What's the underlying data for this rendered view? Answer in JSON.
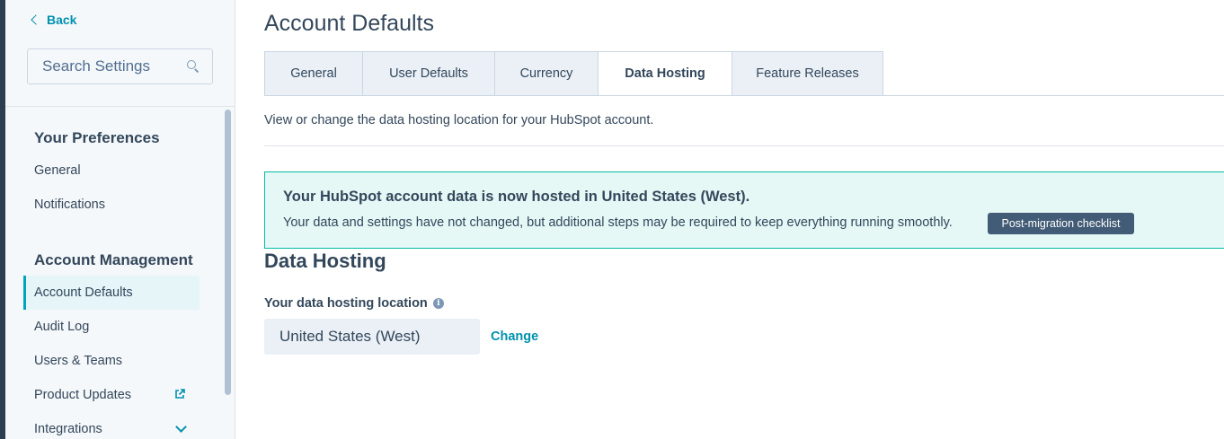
{
  "sidebar": {
    "back_label": "Back",
    "search_placeholder": "Search Settings",
    "sections": [
      {
        "title": "Your Preferences",
        "items": [
          {
            "label": "General"
          },
          {
            "label": "Notifications"
          }
        ]
      },
      {
        "title": "Account Management",
        "items": [
          {
            "label": "Account Defaults",
            "active": true
          },
          {
            "label": "Audit Log"
          },
          {
            "label": "Users & Teams"
          },
          {
            "label": "Product Updates",
            "icon": "external-link-icon"
          },
          {
            "label": "Integrations",
            "icon": "chevron-down-icon"
          }
        ]
      }
    ]
  },
  "main": {
    "page_title": "Account Defaults",
    "tabs": [
      {
        "label": "General"
      },
      {
        "label": "User Defaults"
      },
      {
        "label": "Currency"
      },
      {
        "label": "Data Hosting",
        "active": true
      },
      {
        "label": "Feature Releases"
      }
    ],
    "description": "View or change the data hosting location for your HubSpot account.",
    "alert": {
      "title": "Your HubSpot account data is now hosted in United States (West).",
      "body": "Your data and settings have not changed, but additional steps may be required to keep everything running smoothly.",
      "button_label": "Post-migration checklist"
    },
    "section_heading": "Data Hosting",
    "field_label": "Your data hosting location",
    "location_value": "United States (West)",
    "change_label": "Change"
  },
  "colors": {
    "accent": "#0091ae",
    "active_tab_border": "#00a4bd",
    "alert_background": "#e5f8f6",
    "alert_border": "#00bda5",
    "dark_button": "#425b76"
  }
}
